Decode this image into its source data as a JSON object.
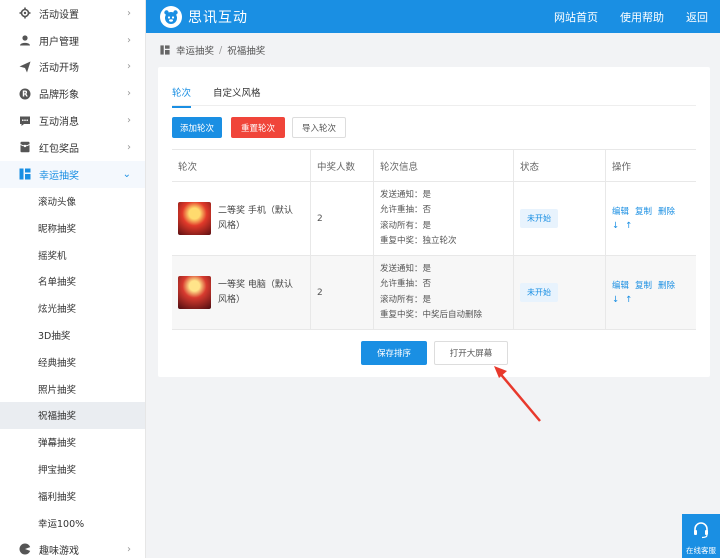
{
  "sidebar": {
    "items": [
      {
        "label": "活动设置",
        "icon": "gear-icon"
      },
      {
        "label": "用户管理",
        "icon": "user-icon"
      },
      {
        "label": "活动开场",
        "icon": "send-icon"
      },
      {
        "label": "品牌形象",
        "icon": "registered-icon"
      },
      {
        "label": "互动消息",
        "icon": "message-icon"
      },
      {
        "label": "红包奖品",
        "icon": "redpacket-icon"
      },
      {
        "label": "幸运抽奖",
        "icon": "lottery-icon"
      }
    ],
    "sub_items": [
      "滚动头像",
      "昵称抽奖",
      "摇奖机",
      "名单抽奖",
      "炫光抽奖",
      "3D抽奖",
      "经典抽奖",
      "照片抽奖",
      "祝福抽奖",
      "弹幕抽奖",
      "押宝抽奖",
      "福利抽奖",
      "幸运100%"
    ],
    "bottom_item": {
      "label": "趣味游戏",
      "icon": "game-icon"
    }
  },
  "header": {
    "logo": "思讯互动",
    "nav": [
      "网站首页",
      "使用帮助",
      "返回"
    ]
  },
  "breadcrumb": {
    "parent": "幸运抽奖",
    "sep": "/",
    "current": "祝福抽奖"
  },
  "tabs": [
    "轮次",
    "自定义风格"
  ],
  "toolbar": {
    "add": "添加轮次",
    "reset": "重置轮次",
    "import": "导入轮次"
  },
  "table": {
    "headers": [
      "轮次",
      "中奖人数",
      "轮次信息",
      "状态",
      "操作"
    ],
    "rows": [
      {
        "name_line1": "二等奖 手机（默认",
        "name_line2": "风格）",
        "count": "2",
        "info": [
          "发送通知：是",
          "允许重抽：否",
          "滚动所有：是",
          "重复中奖：独立轮次"
        ],
        "status": "未开始",
        "ops": [
          "编辑",
          "复制",
          "删除"
        ],
        "move": [
          "↓",
          "↑"
        ]
      },
      {
        "name_line1": "一等奖 电脑（默认",
        "name_line2": "风格）",
        "count": "2",
        "info": [
          "发送通知：是",
          "允许重抽：否",
          "滚动所有：是",
          "重复中奖：中奖后自动删除"
        ],
        "status": "未开始",
        "ops": [
          "编辑",
          "复制",
          "删除"
        ],
        "move": [
          "↓",
          "↑"
        ]
      }
    ]
  },
  "actions": {
    "save": "保存排序",
    "open": "打开大屏幕"
  },
  "help": {
    "label": "在线客服"
  },
  "colors": {
    "primary": "#1a8fe3",
    "danger": "#f0453a",
    "annotation": "#e8392c"
  }
}
